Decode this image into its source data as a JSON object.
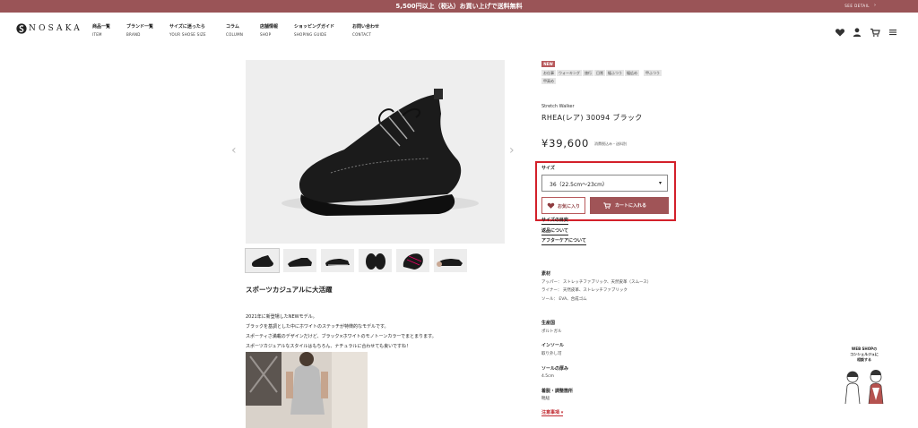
{
  "topbar": {
    "message": "5,500円以上（税込）お買い上げで送料無料",
    "detail_link": "SEE DETAIL",
    "background": "#9a5457"
  },
  "brand_logo": "NOSAKA",
  "nav": [
    {
      "ja": "商品一覧",
      "en": "ITEM"
    },
    {
      "ja": "ブランド一覧",
      "en": "BRAND"
    },
    {
      "ja": "サイズに迷ったら",
      "en": "YOUR SHOSE SIZE"
    },
    {
      "ja": "コラム",
      "en": "COLUMN"
    },
    {
      "ja": "店舗情報",
      "en": "SHOP"
    },
    {
      "ja": "ショッピングガイド",
      "en": "SHOPING GUIDE"
    },
    {
      "ja": "お問い合わせ",
      "en": "CONTACT"
    }
  ],
  "header_icons": [
    "heart-icon",
    "user-icon",
    "cart-icon",
    "menu-icon"
  ],
  "product": {
    "badge": "NEW",
    "tags": [
      "お仕事",
      "ウォーキング",
      "旅行",
      "日常",
      "幅ふつう",
      "幅広め",
      "甲ふつう",
      "甲高め"
    ],
    "brand": "Stretch Walker",
    "name": "RHEA(レア) 30094 ブラック",
    "price": "¥39,600",
    "price_note": "消費税込み・送料別",
    "size_label": "サイズ",
    "size_selected": "36（22.5cm〜23cm）",
    "favorite_label": "お気に入り",
    "cart_label": "カートに入れる",
    "accent": "#a05457"
  },
  "links": {
    "size_guide": "サイズの目安",
    "returns": "返品について",
    "aftercare": "アフターケアについて",
    "caution": "注意事項"
  },
  "specs": [
    {
      "heading": "素材",
      "lines": [
        "アッパー： ストレッチファブリック、天然皮革（スムース）",
        "ライナー： 天然皮革、ストレッチファブリック",
        "ソール： EVA、合成ゴム"
      ]
    },
    {
      "heading": "生産国",
      "lines": [
        "ポルトガル"
      ]
    },
    {
      "heading": "インソール",
      "lines": [
        "取り外し可"
      ]
    },
    {
      "heading": "ソールの厚み",
      "lines": [
        "4.5cm"
      ]
    },
    {
      "heading": "着脱・調整箇所",
      "lines": [
        "靴紐"
      ]
    }
  ],
  "description": {
    "title": "スポーツカジュアルに大活躍",
    "paragraphs": [
      "2021年に新登場したNEWモデル。",
      "ブラックを基調とした中にホワイトのステッチが特徴的なモデルです。",
      "スポーティさ満載のデザインだけど、ブラック×ホワイトのモノトーンカラーでまとまります。",
      "スポーツカジュアルなスタイルはもちろん、ナチュラルに合わせても良いですね！"
    ]
  },
  "concierge": {
    "line1": "WEB SHOPの",
    "line2": "コンシェルジュに",
    "line3": "相談する"
  }
}
